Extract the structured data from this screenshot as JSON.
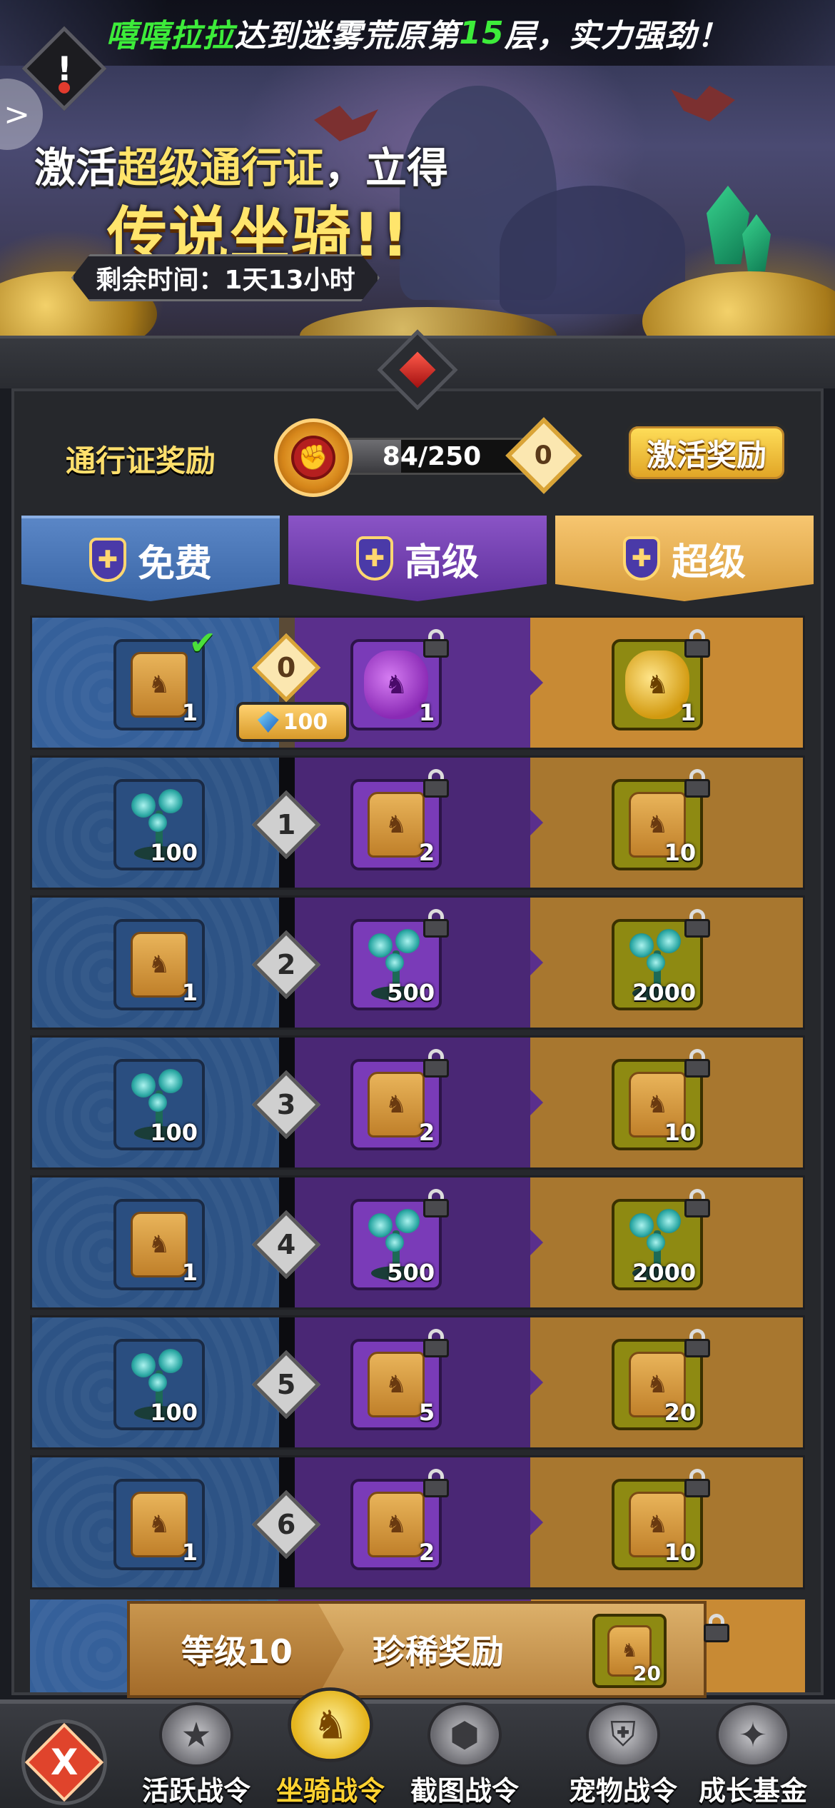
{
  "banner": {
    "ticker_name": "嘻嘻拉拉",
    "ticker_mid": "达到迷雾荒原第",
    "ticker_floor": "15",
    "ticker_end": "层，实力强劲！",
    "headline_prefix": "激活",
    "headline_highlight": "超级通行证",
    "headline_suffix": "，立得",
    "headline_main": "传说坐骑!!",
    "time_remaining": "剩余时间：1天13小时",
    "side_arrow": ">"
  },
  "status": {
    "pass_reward_label": "通行证奖励",
    "progress_text": "84/250",
    "progress_current": 84,
    "progress_max": 250,
    "current_level": "0",
    "activate_button": "激活奖励"
  },
  "tabs": {
    "free": "免费",
    "advanced": "高级",
    "super": "超级"
  },
  "rows": [
    {
      "level": "0",
      "free": {
        "type": "scroll",
        "count": "1",
        "claimed": true
      },
      "adv": {
        "type": "bag-purple",
        "count": "1"
      },
      "sup": {
        "type": "bag-gold",
        "count": "1"
      },
      "gem_cost": "100"
    },
    {
      "level": "1",
      "free": {
        "type": "plant",
        "count": "100"
      },
      "adv": {
        "type": "scroll",
        "count": "2"
      },
      "sup": {
        "type": "scroll",
        "count": "10"
      }
    },
    {
      "level": "2",
      "free": {
        "type": "scroll",
        "count": "1"
      },
      "adv": {
        "type": "plant",
        "count": "500"
      },
      "sup": {
        "type": "plant",
        "count": "2000"
      }
    },
    {
      "level": "3",
      "free": {
        "type": "plant",
        "count": "100"
      },
      "adv": {
        "type": "scroll",
        "count": "2"
      },
      "sup": {
        "type": "scroll",
        "count": "10"
      }
    },
    {
      "level": "4",
      "free": {
        "type": "scroll",
        "count": "1"
      },
      "adv": {
        "type": "plant",
        "count": "500"
      },
      "sup": {
        "type": "plant",
        "count": "2000"
      }
    },
    {
      "level": "5",
      "free": {
        "type": "plant",
        "count": "100"
      },
      "adv": {
        "type": "scroll",
        "count": "5"
      },
      "sup": {
        "type": "scroll",
        "count": "20"
      }
    },
    {
      "level": "6",
      "free": {
        "type": "scroll",
        "count": "1"
      },
      "adv": {
        "type": "scroll",
        "count": "2"
      },
      "sup": {
        "type": "scroll",
        "count": "10"
      }
    }
  ],
  "milestone": {
    "level_label": "等级10",
    "reward_label": "珍稀奖励",
    "item_count": "20"
  },
  "nav": {
    "close_icon": "X",
    "items": [
      {
        "label": "活跃战令",
        "icon": "star-badge-icon"
      },
      {
        "label": "坐骑战令",
        "icon": "horse-icon",
        "active": true
      },
      {
        "label": "截图战令",
        "icon": "shield-badge-icon"
      },
      {
        "label": "宠物战令",
        "icon": "pet-badge-icon"
      },
      {
        "label": "成长基金",
        "icon": "growth-badge-icon"
      }
    ]
  },
  "colors": {
    "free_col": "#35609a",
    "adv_col": "#5a2f8c",
    "super_col": "#c88a34",
    "ticker_highlight": "#3dec3a",
    "gold_text": "#ffe46a"
  }
}
